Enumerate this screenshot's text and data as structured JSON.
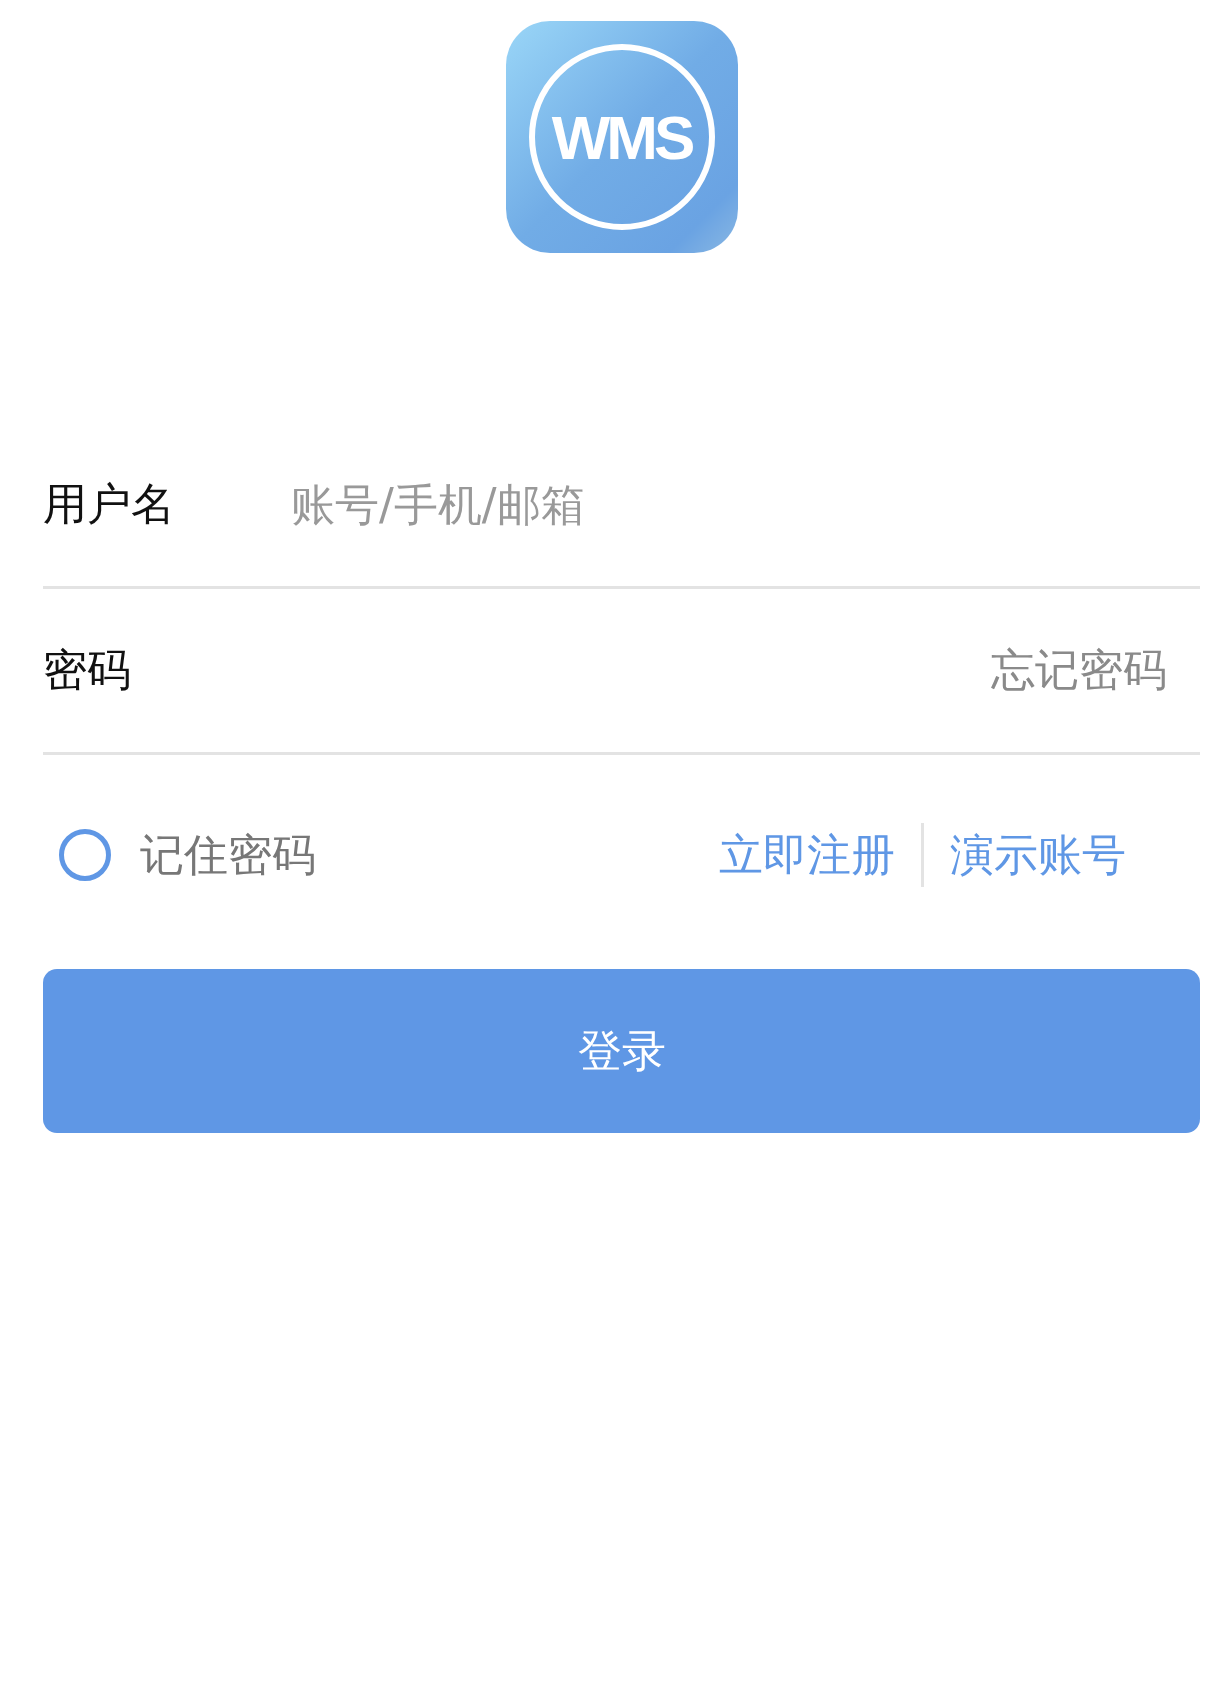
{
  "logo": {
    "text": "WMS"
  },
  "fields": [
    {
      "label": "用户名",
      "placeholder": "账号/手机/邮箱"
    },
    {
      "label": "密码",
      "link": "忘记密码"
    }
  ],
  "remember": {
    "label": "记住密码",
    "checked": false
  },
  "links": [
    "立即注册",
    "演示账号"
  ],
  "login_button": "登录"
}
